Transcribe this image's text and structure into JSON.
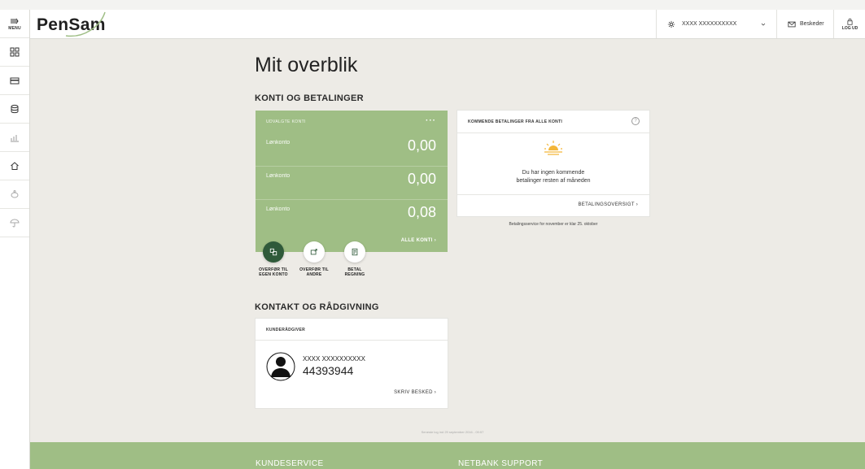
{
  "sidebar": {
    "menu_label": "MENU",
    "items": [
      {
        "icon": "dashboard-icon"
      },
      {
        "icon": "card-icon"
      },
      {
        "icon": "coins-icon"
      },
      {
        "icon": "chart-icon"
      },
      {
        "icon": "home-icon"
      },
      {
        "icon": "piggy-bank-icon"
      },
      {
        "icon": "umbrella-icon"
      }
    ]
  },
  "header": {
    "logo": "PenSam",
    "user_name": "XXXX XXXXXXXXXX",
    "messages_label": "Beskeder",
    "logout_label": "LOG UD"
  },
  "main": {
    "title": "Mit overblik",
    "section_accounts": "KONTI OG BETALINGER",
    "section_contact": "KONTAKT OG RÅDGIVNING"
  },
  "accounts": {
    "header": "UDVALGTE KONTI",
    "more": "···",
    "items": [
      {
        "name": "Lønkonto",
        "amount": "0,00"
      },
      {
        "name": "Lønkonto",
        "amount": "0,00"
      },
      {
        "name": "Lønkonto",
        "amount": "0,08"
      }
    ],
    "all_link": "ALLE KONTI ›"
  },
  "actions": [
    {
      "line1": "OVERFØR TIL",
      "line2": "EGEN KONTO"
    },
    {
      "line1": "OVERFØR TIL",
      "line2": "ANDRE"
    },
    {
      "line1": "BETAL",
      "line2": "REGNING"
    }
  ],
  "upcoming": {
    "header": "KOMMENDE BETALINGER FRA ALLE KONTI",
    "help": "?",
    "message_line1": "Du har ingen kommende",
    "message_line2": "betalinger resten af måneden",
    "link": "BETALINGSOVERSIGT ›",
    "note": "Betalingsservice for november er klar 25. oktober"
  },
  "contact": {
    "header": "KUNDERÅDGIVER",
    "name": "XXXX XXXXXXXXXX",
    "phone": "44393944",
    "link": "SKRIV BESKED ›"
  },
  "last_login": "Seneste log ind 29 september 2016 - 09:57",
  "footer": {
    "col1": "KUNDESERVICE",
    "col2": "NETBANK SUPPORT"
  },
  "colors": {
    "accent_green": "#9fbe85",
    "dark_green": "#2f5a3a",
    "background": "#edebe6"
  }
}
